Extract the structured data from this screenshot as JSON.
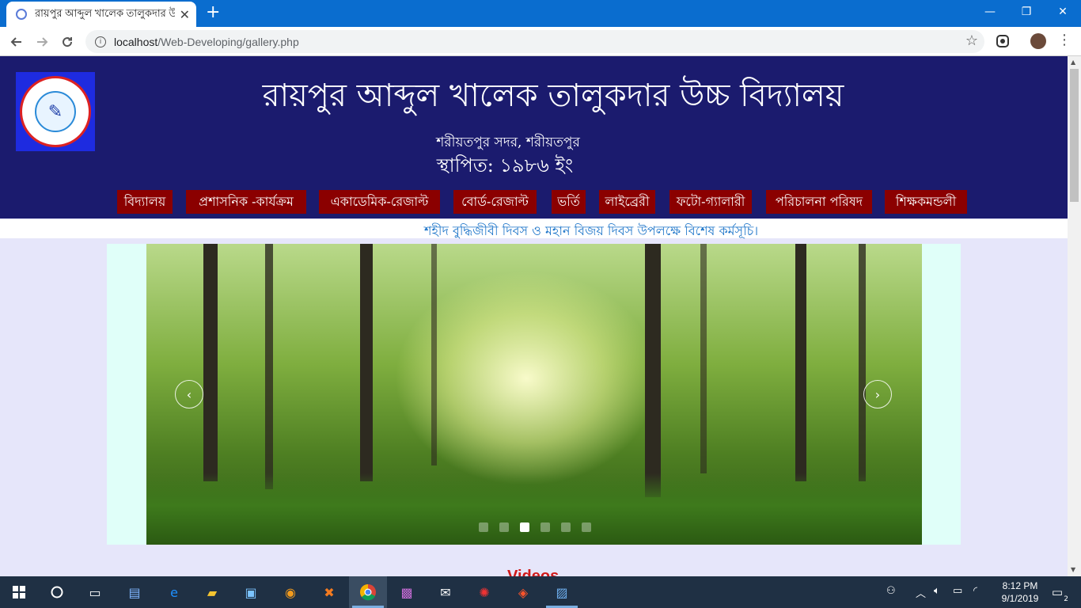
{
  "browser": {
    "tab_title": "রায়পুর আব্দুল খালেক তালুকদার উ",
    "tab_close": "✕",
    "new_tab": "+",
    "url_host": "localhost",
    "url_path": "/Web-Developing/gallery.php",
    "window": {
      "minimize": "—",
      "restore": "❐",
      "close": "✕"
    }
  },
  "site": {
    "title": "রায়পুর আব্দুল খালেক তালুকদার উচ্চ বিদ্যালয়",
    "location": "শরীয়তপুর সদর, শরীয়তপুর",
    "established": "স্থাপিত: ১৯৮৬ ইং",
    "menu": [
      "বিদ্যালয়",
      "প্রশাসনিক -কার্যক্রম",
      "একাডেমিক-রেজাল্ট",
      "বোর্ড-রেজাল্ট",
      "ভর্তি",
      "লাইব্রেরী",
      "ফটো-গ্যালারী",
      "পরিচালনা পরিষদ",
      "শিক্ষকমন্ডলী"
    ],
    "notice": "শহীদ বুদ্ধিজীবী দিবস ও মহান বিজয় দিবস উপলক্ষে বিশেষ কর্মসূচি।",
    "carousel": {
      "slide_count": 6,
      "active_index": 2,
      "prev": "‹",
      "next": "›"
    },
    "videos_heading": "Videos"
  },
  "taskbar": {
    "time": "8:12 PM",
    "date": "9/1/2019",
    "notifications": "2"
  },
  "colors": {
    "header_bg": "#1b1b6e",
    "menu_bg": "#8b0000",
    "notice_text": "#1a73c8",
    "page_bg": "#e6e6fa",
    "slider_frame": "#e0fff9",
    "videos_heading": "#d01818"
  }
}
